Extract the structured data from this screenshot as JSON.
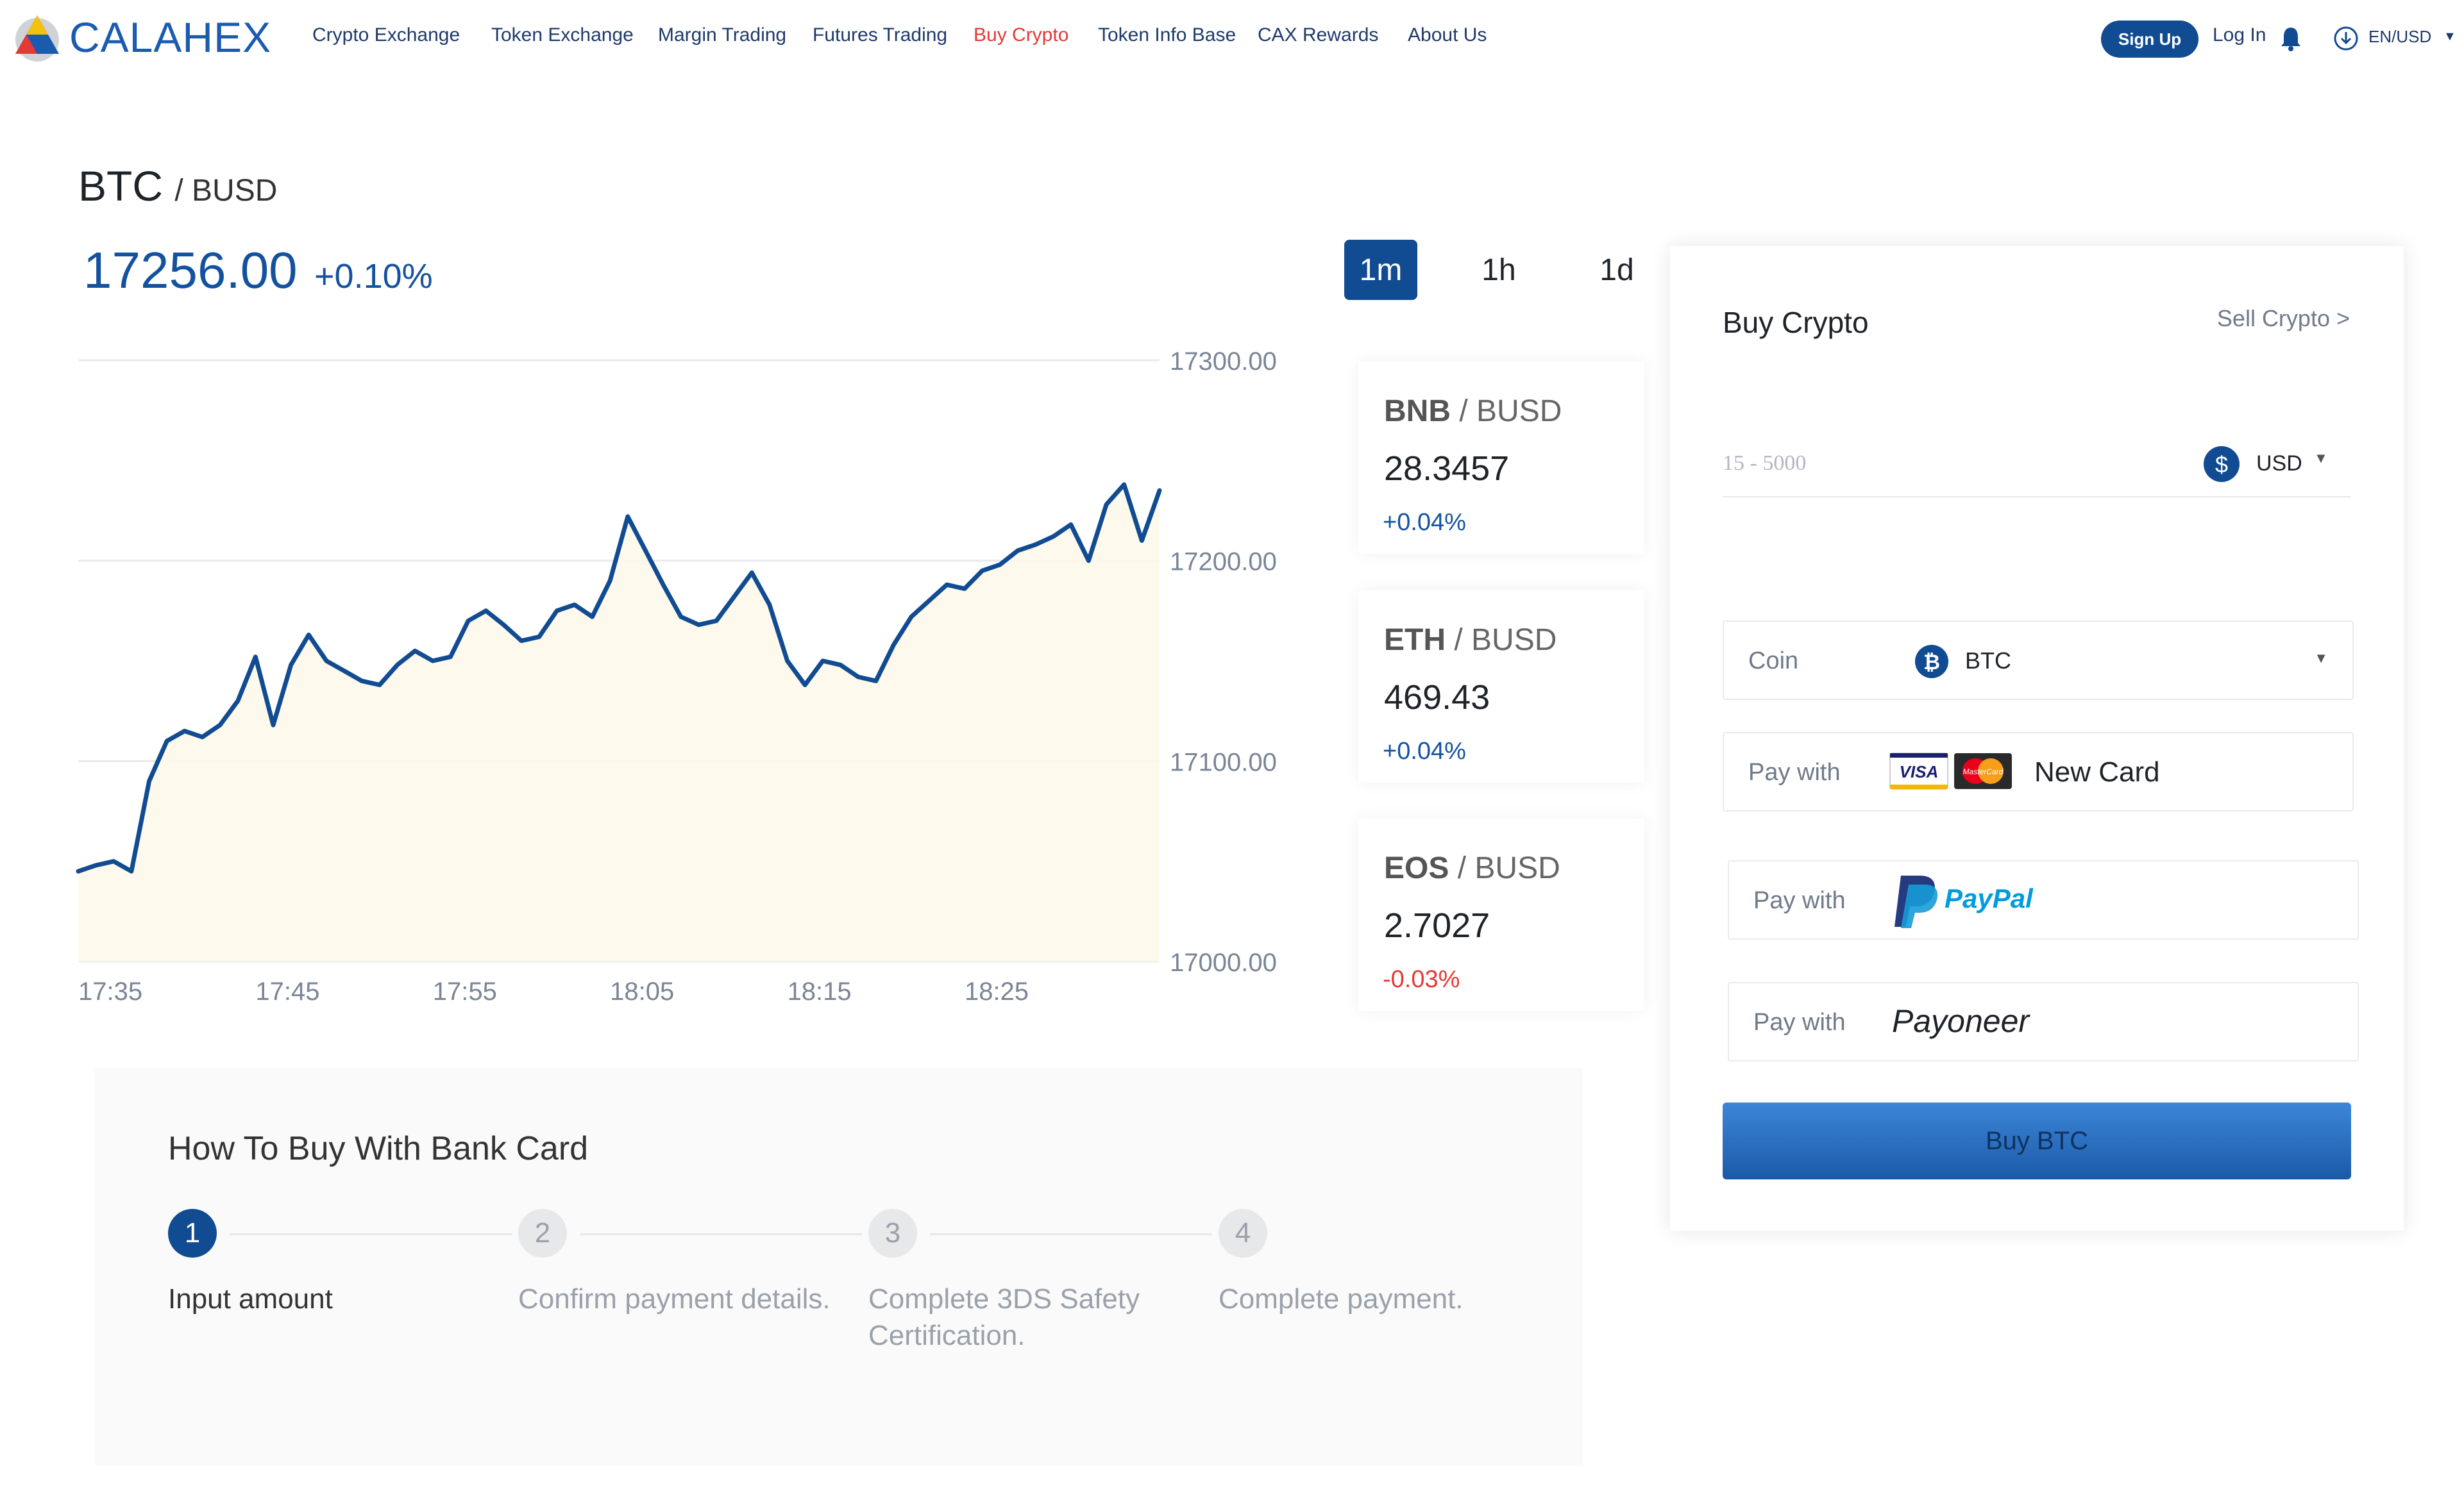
{
  "brand": {
    "name": "CALAHEX"
  },
  "nav": {
    "links": [
      "Crypto Exchange",
      "Token Exchange",
      "Margin Trading",
      "Futures Trading",
      "Buy Crypto",
      "Token Info Base",
      "CAX Rewards",
      "About Us"
    ],
    "active": "Buy Crypto",
    "signup": "Sign Up",
    "login": "Log In",
    "language": "EN/USD"
  },
  "market": {
    "base": "BTC",
    "quote": "/ BUSD",
    "price": "17256.00",
    "change": "+0.10%",
    "timeframes": [
      "1m",
      "1h",
      "1d"
    ],
    "active_timeframe": "1m"
  },
  "chart_data": {
    "type": "line",
    "x": [
      "17:35",
      "17:36",
      "17:37",
      "17:38",
      "17:39",
      "17:40",
      "17:41",
      "17:42",
      "17:43",
      "17:44",
      "17:45",
      "17:46",
      "17:47",
      "17:48",
      "17:49",
      "17:50",
      "17:51",
      "17:52",
      "17:53",
      "17:54",
      "17:55",
      "17:56",
      "17:57",
      "17:58",
      "17:59",
      "18:00",
      "18:01",
      "18:02",
      "18:03",
      "18:04",
      "18:05",
      "18:06",
      "18:07",
      "18:08",
      "18:09",
      "18:10",
      "18:11",
      "18:12",
      "18:13",
      "18:14",
      "18:15",
      "18:16",
      "18:17",
      "18:18",
      "18:19",
      "18:20",
      "18:21",
      "18:22",
      "18:23",
      "18:24",
      "18:25",
      "18:26",
      "18:27",
      "18:28",
      "18:29",
      "18:30",
      "18:31",
      "18:32",
      "18:33",
      "18:34",
      "18:35",
      "18:36"
    ],
    "values": [
      17045,
      17048,
      17050,
      17045,
      17090,
      17110,
      17115,
      17112,
      17118,
      17130,
      17152,
      17118,
      17148,
      17163,
      17150,
      17145,
      17140,
      17138,
      17148,
      17155,
      17150,
      17152,
      17170,
      17175,
      17168,
      17160,
      17162,
      17175,
      17178,
      17172,
      17190,
      17222,
      17205,
      17188,
      17172,
      17168,
      17170,
      17182,
      17194,
      17178,
      17150,
      17138,
      17150,
      17148,
      17142,
      17140,
      17158,
      17172,
      17180,
      17188,
      17186,
      17195,
      17198,
      17205,
      17208,
      17212,
      17218,
      17200,
      17228,
      17238,
      17210,
      17235
    ],
    "yticks": [
      "17300.00",
      "17200.00",
      "17100.00",
      "17000.00"
    ],
    "xticks": [
      "17:35",
      "17:45",
      "17:55",
      "18:05",
      "18:15",
      "18:25"
    ],
    "ylim": [
      17000,
      17300
    ],
    "grid": true,
    "color": "#114b92"
  },
  "tickers": [
    {
      "base": "BNB",
      "quote": " / BUSD",
      "price": "28.3457",
      "change": "+0.04%",
      "dir": "up"
    },
    {
      "base": "ETH",
      "quote": " / BUSD",
      "price": "469.43",
      "change": "+0.04%",
      "dir": "up"
    },
    {
      "base": "EOS",
      "quote": " / BUSD",
      "price": "2.7027",
      "change": "-0.03%",
      "dir": "down"
    }
  ],
  "colors": {
    "up": "#1452a0",
    "down": "#e53935",
    "accent": "#114b92"
  },
  "buy": {
    "title": "Buy Crypto",
    "sell_link": "Sell Crypto >",
    "amount_placeholder": "15 - 5000",
    "fiat": "USD",
    "coin_label": "Coin",
    "coin": "BTC",
    "pay_label": "Pay with",
    "card_label": "New Card",
    "visa": "VISA",
    "mastercard": "MasterCard",
    "paypal": "PayPal",
    "payoneer": "Payoneer",
    "button": "Buy BTC"
  },
  "howto": {
    "title": "How To Buy With Bank Card",
    "steps": [
      {
        "num": "1",
        "text": "Input amount"
      },
      {
        "num": "2",
        "text": "Confirm payment details."
      },
      {
        "num": "3",
        "text": "Complete 3DS Safety Certification."
      },
      {
        "num": "4",
        "text": "Complete payment."
      }
    ]
  }
}
